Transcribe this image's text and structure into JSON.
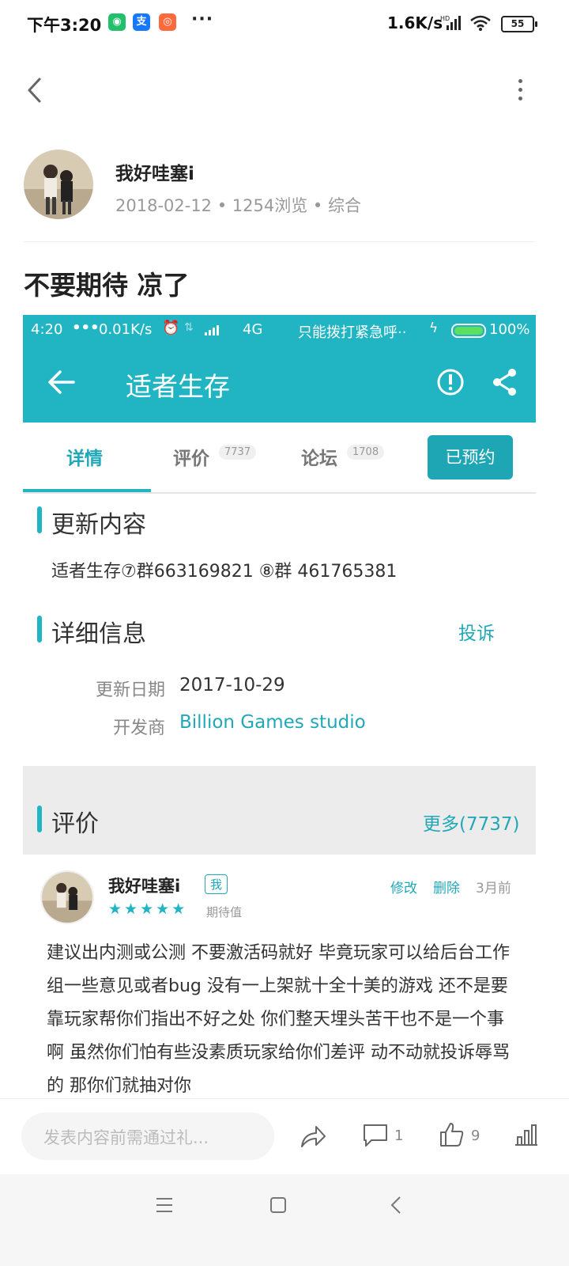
{
  "status_bar": {
    "time": "下午3:20",
    "network_speed": "1.6K/s",
    "battery": "55"
  },
  "post": {
    "author": "我好哇塞i",
    "meta": "2018-02-12 • 1254浏览 • 综合",
    "title": "不要期待 凉了"
  },
  "embedded": {
    "status": {
      "time": "4:20",
      "dots": "•••",
      "speed": "0.01K/s",
      "network": "4G",
      "carrier": "只能拨打紧急呼··",
      "battery": "100%"
    },
    "app_title": "适者生存",
    "tabs": [
      {
        "label": "详情"
      },
      {
        "label": "评价",
        "badge": "7737"
      },
      {
        "label": "论坛",
        "badge": "1708"
      }
    ],
    "reserve_button": "已预约",
    "update_section": {
      "title": "更新内容",
      "text": "适者生存⑦群663169821 ⑧群 461765381"
    },
    "detail_section": {
      "title": "详细信息",
      "report": "投诉",
      "update_date_label": "更新日期",
      "update_date_value": "2017-10-29",
      "developer_label": "开发商",
      "developer_value": "Billion Games studio"
    },
    "review_section": {
      "title": "评价",
      "more": "更多(7737)"
    },
    "review": {
      "name": "我好哇塞i",
      "me_badge": "我",
      "edit": "修改",
      "delete": "删除",
      "time": "3月前",
      "stars": "★★★★★",
      "rating": 5,
      "expect": "期待值",
      "text": "建议出内测或公测 不要激活码就好 毕竟玩家可以给后台工作组一些意见或者bug 没有一上架就十全十美的游戏 还不是要靠玩家帮你们指出不好之处 你们整天埋头苦干也不是一个事啊 虽然你们怕有些没素质玩家给你们差评 动不动就投诉辱骂的 那你们就抽对你"
    }
  },
  "bottom_bar": {
    "comment_placeholder": "发表内容前需通过礼...",
    "comment_count": "1",
    "like_count": "9"
  },
  "colors": {
    "accent": "#21b5c4",
    "accent_dark": "#1ea6b5",
    "link": "#21a8b8"
  },
  "icons": [
    "back-chevron-icon",
    "more-vert-icon",
    "arrow-left-icon",
    "alert-icon",
    "share-icon",
    "forward-icon",
    "comment-icon",
    "thumbs-up-icon",
    "stats-icon",
    "menu-icon",
    "home-square-icon",
    "back-triangle-icon"
  ]
}
